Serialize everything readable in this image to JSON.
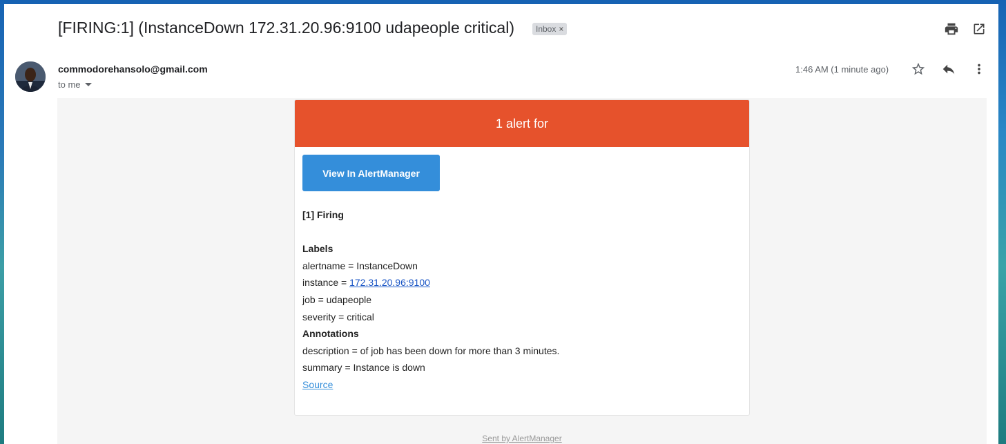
{
  "email": {
    "subject": "[FIRING:1] (InstanceDown 172.31.20.96:9100 udapeople critical)",
    "label_chip": "Inbox",
    "label_chip_remove": "×",
    "sender": "commodorehansolo@gmail.com",
    "recipient": "to me",
    "timestamp": "1:46 AM (1 minute ago)",
    "icons": [
      "print-icon",
      "open-in-new-window-icon",
      "star-icon",
      "reply-icon",
      "more-vert-icon",
      "dropdown-caret-icon"
    ]
  },
  "alert": {
    "header": "1 alert for",
    "header_color": "#e6522c",
    "button_label": "View In AlertManager",
    "button_color": "#348eda",
    "firing": "[1] Firing",
    "labels_heading": "Labels",
    "alertname": "alertname = InstanceDown",
    "instance_prefix": "instance = ",
    "instance_link": "172.31.20.96:9100",
    "job": "job = udapeople",
    "severity": "severity = critical",
    "annotations_heading": "Annotations",
    "description": "description = of job has been down for more than 3 minutes.",
    "summary": "summary = Instance is down",
    "source_link": "Source",
    "footer": "Sent by AlertManager"
  }
}
